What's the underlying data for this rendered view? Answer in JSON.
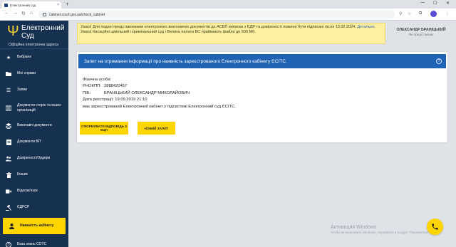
{
  "browser": {
    "tab_title": "Електронний суд",
    "url": "cabinet.court.gov.ua/check_cabinet",
    "new_tab": "+",
    "minimize": "—",
    "maximize": "☐",
    "close": "✕"
  },
  "sidebar": {
    "logo_line1": "Електронний",
    "logo_line2": "Суд",
    "logo_sub": "Офіційна електронна адреса",
    "items": [
      {
        "label": "Вибране",
        "icon": "star-icon"
      },
      {
        "label": "Мої справи",
        "icon": "folder-icon"
      },
      {
        "label": "Заяви",
        "icon": "list-icon"
      },
      {
        "label": "Документи сторін та інших організацій",
        "icon": "documents-icon"
      },
      {
        "label": "Виконавчі документи",
        "icon": "layers-icon"
      },
      {
        "label": "Документи ВП",
        "icon": "document-icon"
      },
      {
        "label": "Довіреності/Ордери",
        "icon": "users-icon"
      },
      {
        "label": "Кошик",
        "icon": "trash-icon"
      },
      {
        "label": "Відеозв'язок",
        "icon": "video-icon"
      },
      {
        "label": "ЄДРСР",
        "icon": "gavel-icon"
      },
      {
        "label": "Наявність кабінету",
        "icon": "person-icon"
      },
      {
        "label": "База знань СОТС",
        "icon": "help-icon"
      }
    ]
  },
  "notice": {
    "line1": "Увага! Для подачі представниками електронних виконавчих документів до АСВП виписки з ЄДР та довіреності повинні бути підписані після 13.02.2024.",
    "link": "Детально.",
    "line2": "Увага! Касаційні цивільний і кримінальний суд і Велика палата ВС приймають файли до 500 Мб."
  },
  "user": {
    "name": "ОЛЕКСАНДР БРАНІЦЬКИЙ",
    "role": "Як представник"
  },
  "card": {
    "title": "Запит на отримання інформації про наявність зареєстрованого Електронного кабінету ЄСІТС.",
    "help": "?",
    "person_type": "Фізична особа:",
    "rnokpp_label": "РНОКПП:",
    "rnokpp_value": "2888420457",
    "pib_label": "ПІБ:",
    "pib_value": "БРАНІЦЬКИЙ ОЛЕКСАНДР МИКОЛАЙОВИЧ",
    "reg_date": "Дата реєстрації: 19.09.2019 21:10",
    "status": "має зареєстрований Електронний кабінет у підсистемі Електронний суд ЄСІТС.",
    "btn_answer": "СФОРМУВАТИ ВІДПОВІДЬ З ЕЦП",
    "btn_new": "НОВИЙ ЗАПИТ"
  },
  "watermark": {
    "line1": "Активация Windows",
    "line2": "Чтобы активировать Windows, перейдите в раздел \"Параметры\"."
  },
  "colors": {
    "sidebar_bg": "#16304f",
    "accent_yellow": "#ffd500",
    "header_blue": "#1f63b4",
    "notice_bg": "#fdf0a0"
  }
}
